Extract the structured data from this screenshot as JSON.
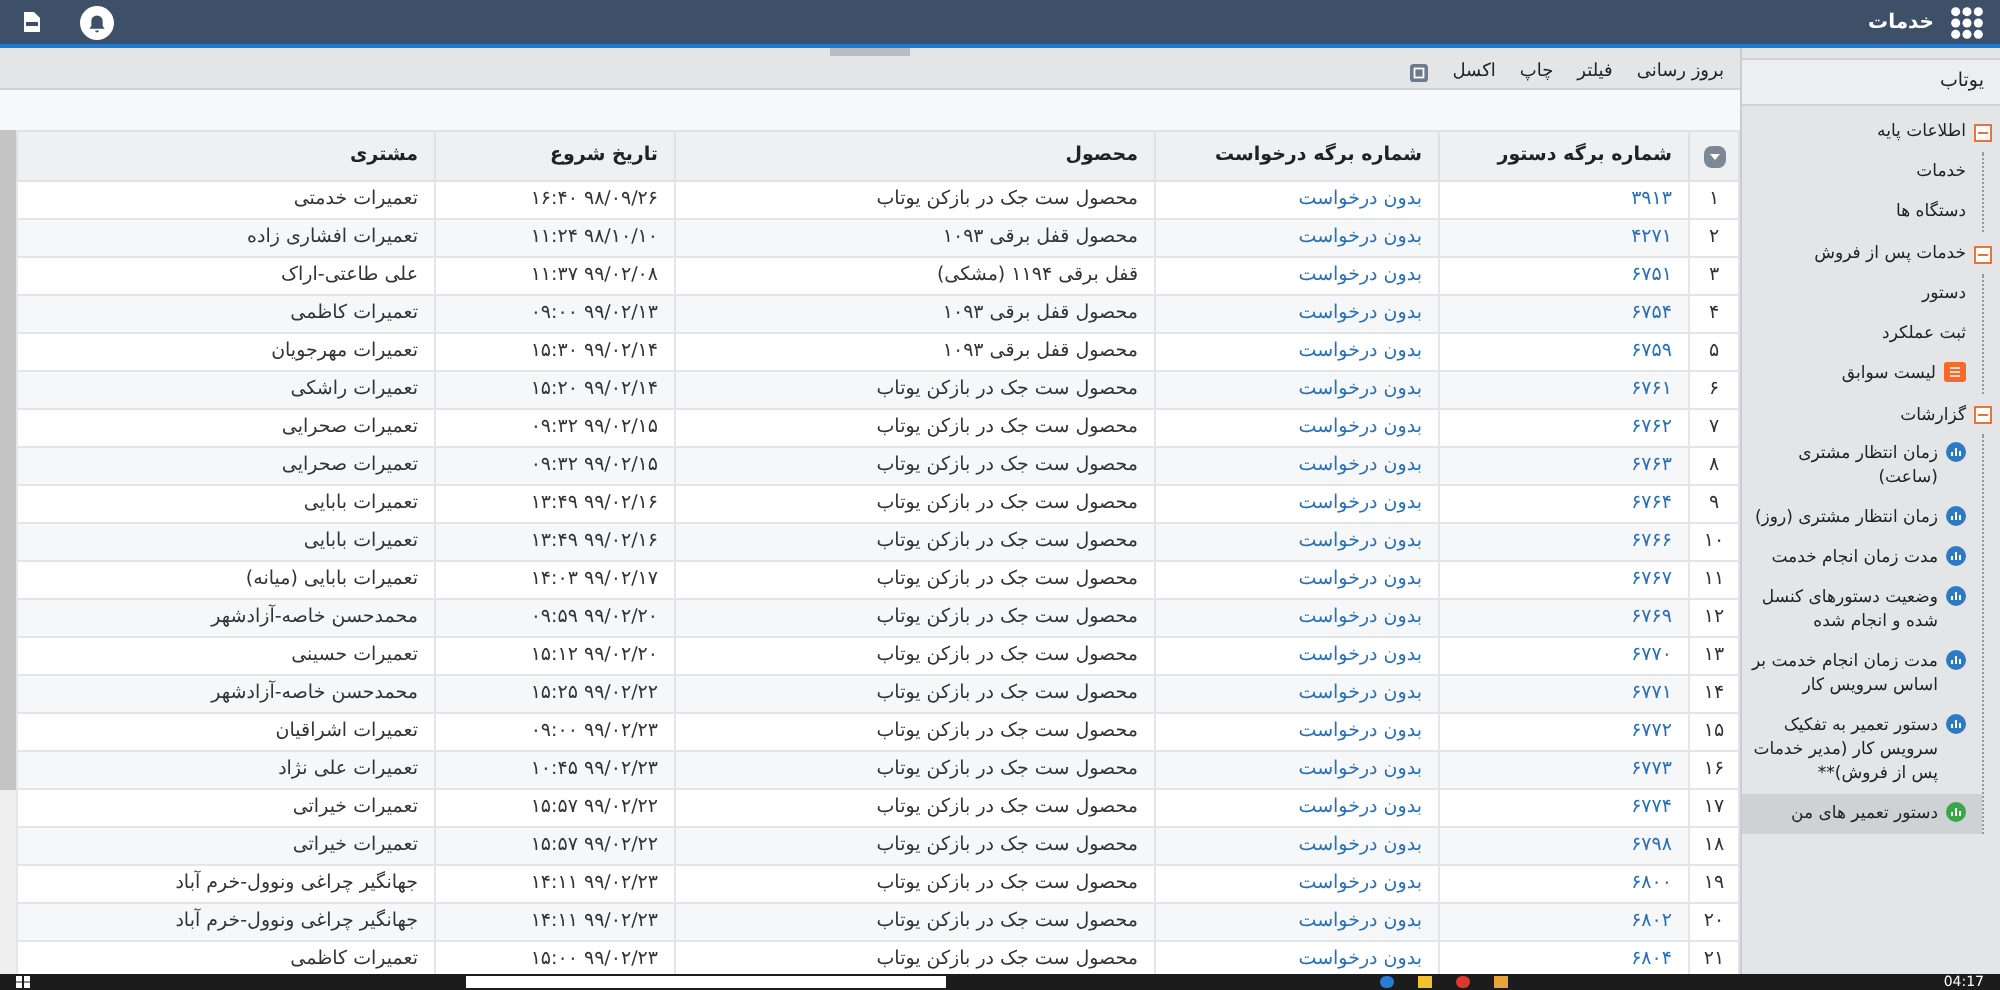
{
  "app_bar": {
    "title": "خدمات"
  },
  "sidebar": {
    "title": "یوتاب",
    "tree": [
      {
        "label": "اطلاعات پایه",
        "expanded": true,
        "children": [
          {
            "label": "خدمات",
            "kind": "plain",
            "selected": false
          },
          {
            "label": "دستگاه ها",
            "kind": "plain",
            "selected": false
          }
        ]
      },
      {
        "label": "خدمات پس از فروش",
        "expanded": true,
        "children": [
          {
            "label": "دستور",
            "kind": "plain",
            "selected": false
          },
          {
            "label": "ثبت عملکرد",
            "kind": "plain",
            "selected": false
          },
          {
            "label": "لیست سوابق",
            "kind": "history",
            "selected": false
          }
        ]
      },
      {
        "label": "گزارشات",
        "expanded": true,
        "children": [
          {
            "label": "زمان انتظار مشتری (ساعت)",
            "kind": "report",
            "color": "#2f78c4",
            "selected": false
          },
          {
            "label": "زمان انتظار مشتری (روز)",
            "kind": "report",
            "color": "#2f78c4",
            "selected": false
          },
          {
            "label": "مدت زمان انجام خدمت",
            "kind": "report",
            "color": "#2f78c4",
            "selected": false
          },
          {
            "label": "وضعیت دستورهای کنسل شده و انجام شده",
            "kind": "report",
            "color": "#2f78c4",
            "selected": false
          },
          {
            "label": "مدت زمان انجام خدمت بر اساس سرویس کار",
            "kind": "report",
            "color": "#2f78c4",
            "selected": false
          },
          {
            "label": "دستور تعمیر به تفکیک سرویس کار (مدیر خدمات پس از فروش)**",
            "kind": "report",
            "color": "#2f78c4",
            "selected": false
          },
          {
            "label": "دستور تعمیر های من",
            "kind": "report",
            "color": "#3ba54a",
            "selected": true
          }
        ]
      }
    ]
  },
  "toolbar": {
    "buttons": [
      "بروز رسانی",
      "فیلتر",
      "چاپ",
      "اکسل"
    ]
  },
  "table": {
    "columns": [
      "شماره برگه دستور",
      "شماره برگه درخواست",
      "محصول",
      "تاریخ شروع",
      "مشتری"
    ],
    "rows": [
      {
        "index": "۱",
        "order": "۳۹۱۳",
        "request": "بدون درخواست",
        "product": "محصول ست جک در بازکن یوتاب",
        "start": "۹۸/۰۹/۲۶ ۱۶:۴۰",
        "customer": "تعمیرات خدمتی"
      },
      {
        "index": "۲",
        "order": "۴۲۷۱",
        "request": "بدون درخواست",
        "product": "محصول قفل برقی ۱۰۹۳",
        "start": "۹۸/۱۰/۱۰ ۱۱:۲۴",
        "customer": "تعمیرات افشاری زاده"
      },
      {
        "index": "۳",
        "order": "۶۷۵۱",
        "request": "بدون درخواست",
        "product": "قفل برقی ۱۱۹۴ (مشکی)",
        "start": "۹۹/۰۲/۰۸ ۱۱:۳۷",
        "customer": "علی طاعتی-اراک"
      },
      {
        "index": "۴",
        "order": "۶۷۵۴",
        "request": "بدون درخواست",
        "product": "محصول قفل برقی ۱۰۹۳",
        "start": "۹۹/۰۲/۱۳ ۰۹:۰۰",
        "customer": "تعمیرات کاظمی"
      },
      {
        "index": "۵",
        "order": "۶۷۵۹",
        "request": "بدون درخواست",
        "product": "محصول قفل برقی ۱۰۹۳",
        "start": "۹۹/۰۲/۱۴ ۱۵:۳۰",
        "customer": "تعمیرات مهرجویان"
      },
      {
        "index": "۶",
        "order": "۶۷۶۱",
        "request": "بدون درخواست",
        "product": "محصول ست جک در بازکن یوتاب",
        "start": "۹۹/۰۲/۱۴ ۱۵:۲۰",
        "customer": "تعمیرات راشکی"
      },
      {
        "index": "۷",
        "order": "۶۷۶۲",
        "request": "بدون درخواست",
        "product": "محصول ست جک در بازکن یوتاب",
        "start": "۹۹/۰۲/۱۵ ۰۹:۳۲",
        "customer": "تعمیرات صحرایی"
      },
      {
        "index": "۸",
        "order": "۶۷۶۳",
        "request": "بدون درخواست",
        "product": "محصول ست جک در بازکن یوتاب",
        "start": "۹۹/۰۲/۱۵ ۰۹:۳۲",
        "customer": "تعمیرات صحرایی"
      },
      {
        "index": "۹",
        "order": "۶۷۶۴",
        "request": "بدون درخواست",
        "product": "محصول ست جک در بازکن یوتاب",
        "start": "۹۹/۰۲/۱۶ ۱۳:۴۹",
        "customer": "تعمیرات بابایی"
      },
      {
        "index": "۱۰",
        "order": "۶۷۶۶",
        "request": "بدون درخواست",
        "product": "محصول ست جک در بازکن یوتاب",
        "start": "۹۹/۰۲/۱۶ ۱۳:۴۹",
        "customer": "تعمیرات بابایی"
      },
      {
        "index": "۱۱",
        "order": "۶۷۶۷",
        "request": "بدون درخواست",
        "product": "محصول ست جک در بازکن یوتاب",
        "start": "۹۹/۰۲/۱۷ ۱۴:۰۳",
        "customer": "تعمیرات بابایی (میانه)"
      },
      {
        "index": "۱۲",
        "order": "۶۷۶۹",
        "request": "بدون درخواست",
        "product": "محصول ست جک در بازکن یوتاب",
        "start": "۹۹/۰۲/۲۰ ۰۹:۵۹",
        "customer": "محمدحسن خاصه-آزادشهر"
      },
      {
        "index": "۱۳",
        "order": "۶۷۷۰",
        "request": "بدون درخواست",
        "product": "محصول ست جک در بازکن یوتاب",
        "start": "۹۹/۰۲/۲۰ ۱۵:۱۲",
        "customer": "تعمیرات حسینی"
      },
      {
        "index": "۱۴",
        "order": "۶۷۷۱",
        "request": "بدون درخواست",
        "product": "محصول ست جک در بازکن یوتاب",
        "start": "۹۹/۰۲/۲۲ ۱۵:۲۵",
        "customer": "محمدحسن خاصه-آزادشهر"
      },
      {
        "index": "۱۵",
        "order": "۶۷۷۲",
        "request": "بدون درخواست",
        "product": "محصول ست جک در بازکن یوتاب",
        "start": "۹۹/۰۲/۲۳ ۰۹:۰۰",
        "customer": "تعمیرات اشراقیان"
      },
      {
        "index": "۱۶",
        "order": "۶۷۷۳",
        "request": "بدون درخواست",
        "product": "محصول ست جک در بازکن یوتاب",
        "start": "۹۹/۰۲/۲۳ ۱۰:۴۵",
        "customer": "تعمیرات علی نژاد"
      },
      {
        "index": "۱۷",
        "order": "۶۷۷۴",
        "request": "بدون درخواست",
        "product": "محصول ست جک در بازکن یوتاب",
        "start": "۹۹/۰۲/۲۲ ۱۵:۵۷",
        "customer": "تعمیرات خیراتی"
      },
      {
        "index": "۱۸",
        "order": "۶۷۹۸",
        "request": "بدون درخواست",
        "product": "محصول ست جک در بازکن یوتاب",
        "start": "۹۹/۰۲/۲۲ ۱۵:۵۷",
        "customer": "تعمیرات خیراتی"
      },
      {
        "index": "۱۹",
        "order": "۶۸۰۰",
        "request": "بدون درخواست",
        "product": "محصول ست جک در بازکن یوتاب",
        "start": "۹۹/۰۲/۲۳ ۱۴:۱۱",
        "customer": "جهانگیر چراغی ونوول-خرم آباد"
      },
      {
        "index": "۲۰",
        "order": "۶۸۰۲",
        "request": "بدون درخواست",
        "product": "محصول ست جک در بازکن یوتاب",
        "start": "۹۹/۰۲/۲۳ ۱۴:۱۱",
        "customer": "جهانگیر چراغی ونوول-خرم آباد"
      },
      {
        "index": "۲۱",
        "order": "۶۸۰۴",
        "request": "بدون درخواست",
        "product": "محصول ست جک در بازکن یوتاب",
        "start": "۹۹/۰۲/۲۳ ۱۵:۰۰",
        "customer": "تعمیرات کاظمی"
      }
    ]
  },
  "taskbar": {
    "clock": "04:17"
  }
}
